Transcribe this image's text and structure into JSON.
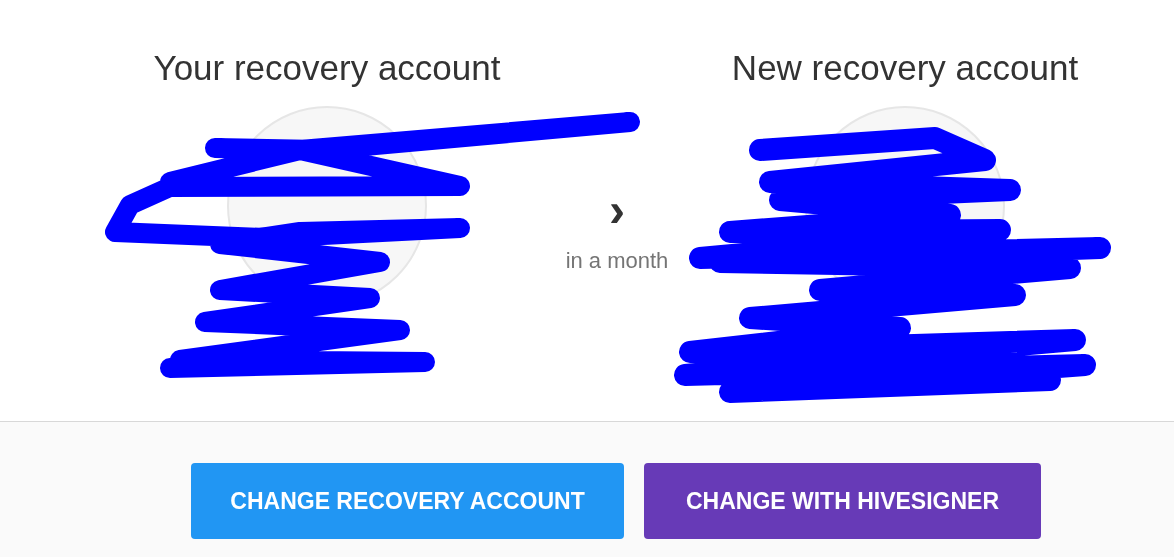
{
  "accounts": [
    {
      "heading": "Your recovery account"
    },
    {
      "heading": "New recovery account"
    }
  ],
  "arrow": {
    "glyph": "›",
    "caption": "in a month"
  },
  "buttons": [
    {
      "label": "CHANGE RECOVERY ACCOUNT",
      "color": "#2196f3"
    },
    {
      "label": "CHANGE WITH HIVESIGNER",
      "color": "#673ab7"
    }
  ]
}
